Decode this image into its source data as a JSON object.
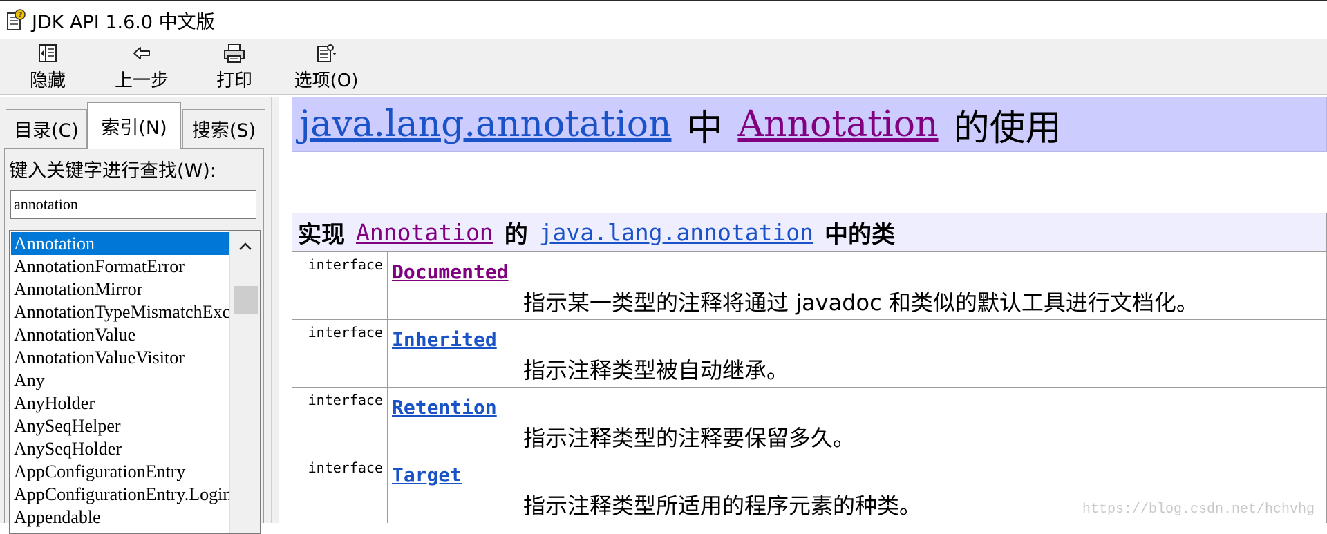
{
  "window": {
    "title": "JDK API 1.6.0 中文版"
  },
  "toolbar": {
    "buttons": [
      {
        "label": "隐藏",
        "icon": "hide-pane-icon"
      },
      {
        "label": "上一步",
        "icon": "back-arrow-icon"
      },
      {
        "label": "打印",
        "icon": "printer-icon"
      },
      {
        "label": "选项(O)",
        "icon": "options-icon"
      }
    ]
  },
  "nav": {
    "tabs": [
      {
        "label": "目录(C)",
        "active": false
      },
      {
        "label": "索引(N)",
        "active": true
      },
      {
        "label": "搜索(S)",
        "active": false
      }
    ],
    "keyword_label": "键入关键字进行查找(W):",
    "search_value": "annotation",
    "index_items": [
      "Annotation",
      "AnnotationFormatError",
      "AnnotationMirror",
      "AnnotationTypeMismatchException",
      "AnnotationValue",
      "AnnotationValueVisitor",
      "Any",
      "AnyHolder",
      "AnySeqHelper",
      "AnySeqHolder",
      "AppConfigurationEntry",
      "AppConfigurationEntry.LoginModuleControlFlag",
      "Appendable"
    ],
    "selected_index": 0
  },
  "content": {
    "header": {
      "package_link": "java.lang.annotation",
      "mid_text": "中",
      "class_link": "Annotation",
      "suffix": "的使用"
    },
    "table": {
      "prefix": "实现",
      "class_link": "Annotation",
      "mid": "的",
      "package_link": "java.lang.annotation",
      "suffix": "中的类"
    },
    "rows": [
      {
        "type": "interface",
        "name": "Documented",
        "visited": true,
        "desc": "指示某一类型的注释将通过 javadoc 和类似的默认工具进行文档化。"
      },
      {
        "type": "interface",
        "name": "Inherited",
        "visited": false,
        "desc": "指示注释类型被自动继承。"
      },
      {
        "type": "interface",
        "name": "Retention",
        "visited": false,
        "desc": "指示注释类型的注释要保留多久。"
      },
      {
        "type": "interface",
        "name": "Target",
        "visited": false,
        "desc": "指示注释类型所适用的程序元素的种类。"
      }
    ],
    "watermark": "https://blog.csdn.net/hchvhg"
  },
  "colors": {
    "link": "#1a52c8",
    "visited_link": "#800080",
    "header_bg": "#ccccff",
    "table_head_bg": "#eeeeff",
    "selection": "#0078d7"
  }
}
